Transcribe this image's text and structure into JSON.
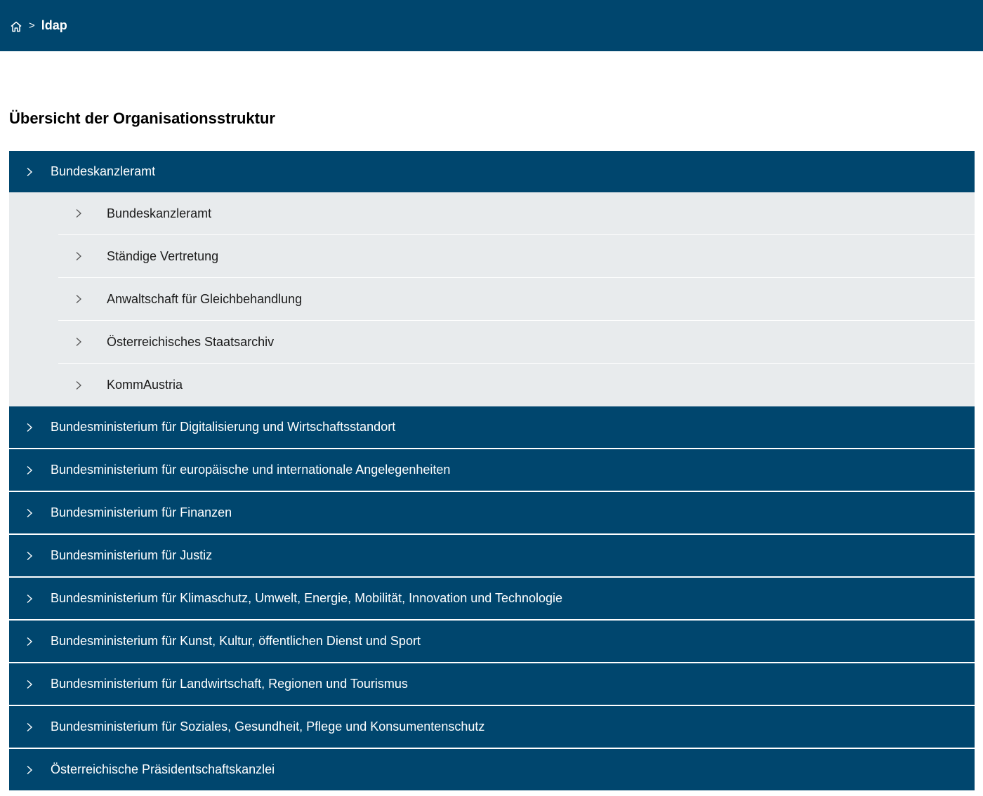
{
  "breadcrumb": {
    "home_icon": "home-icon",
    "separator": ">",
    "current": "ldap"
  },
  "page_title": "Übersicht der Organisationsstruktur",
  "tree": {
    "expanded": {
      "label": "Bundeskanzleramt",
      "children": [
        {
          "label": "Bundeskanzleramt"
        },
        {
          "label": "Ständige Vertretung"
        },
        {
          "label": "Anwaltschaft für Gleichbehandlung"
        },
        {
          "label": "Österreichisches Staatsarchiv"
        },
        {
          "label": "KommAustria"
        }
      ]
    },
    "items": [
      {
        "label": "Bundesministerium für Digitalisierung und Wirtschaftsstandort"
      },
      {
        "label": "Bundesministerium für europäische und internationale Angelegenheiten"
      },
      {
        "label": "Bundesministerium für Finanzen"
      },
      {
        "label": "Bundesministerium für Justiz"
      },
      {
        "label": "Bundesministerium für Klimaschutz, Umwelt, Energie, Mobilität, Innovation und Technologie"
      },
      {
        "label": "Bundesministerium für Kunst, Kultur, öffentlichen Dienst und Sport"
      },
      {
        "label": "Bundesministerium für Landwirtschaft, Regionen und Tourismus"
      },
      {
        "label": "Bundesministerium für Soziales, Gesundheit, Pflege und Konsumentenschutz"
      },
      {
        "label": "Österreichische Präsidentschaftskanzlei"
      }
    ]
  },
  "colors": {
    "primary": "#00466e",
    "child_bg": "#e8ebed",
    "child_text": "#1c1c1c"
  }
}
